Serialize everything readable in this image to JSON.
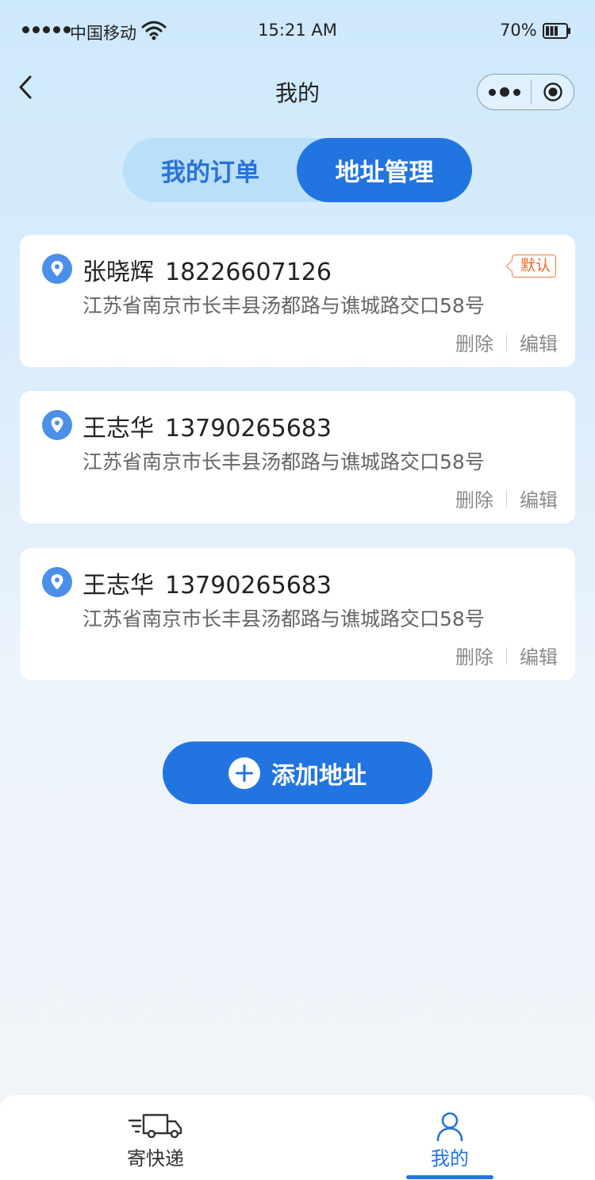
{
  "status_bar": {
    "carrier": "中国移动",
    "time": "15:21 AM",
    "battery": "70%"
  },
  "nav": {
    "title": "我的"
  },
  "segment": {
    "tabs": [
      {
        "label": "我的订单",
        "active": false
      },
      {
        "label": "地址管理",
        "active": true
      }
    ]
  },
  "addresses": [
    {
      "name": "张晓辉",
      "phone": "18226607126",
      "address": "江苏省南京市长丰县汤都路与谯城路交口58号",
      "default_label": "默认",
      "is_default": true,
      "delete_label": "删除",
      "edit_label": "编辑"
    },
    {
      "name": "王志华",
      "phone": "13790265683",
      "address": "江苏省南京市长丰县汤都路与谯城路交口58号",
      "is_default": false,
      "delete_label": "删除",
      "edit_label": "编辑"
    },
    {
      "name": "王志华",
      "phone": "13790265683",
      "address": "江苏省南京市长丰县汤都路与谯城路交口58号",
      "is_default": false,
      "delete_label": "删除",
      "edit_label": "编辑"
    }
  ],
  "add_button": {
    "label": "添加地址"
  },
  "tabbar": {
    "items": [
      {
        "label": "寄快递",
        "icon": "truck-icon",
        "active": false
      },
      {
        "label": "我的",
        "icon": "user-icon",
        "active": true
      }
    ]
  },
  "colors": {
    "accent": "#2274e1",
    "default_tag": "#ec6a2a",
    "segment_bg": "#b9dff9"
  }
}
